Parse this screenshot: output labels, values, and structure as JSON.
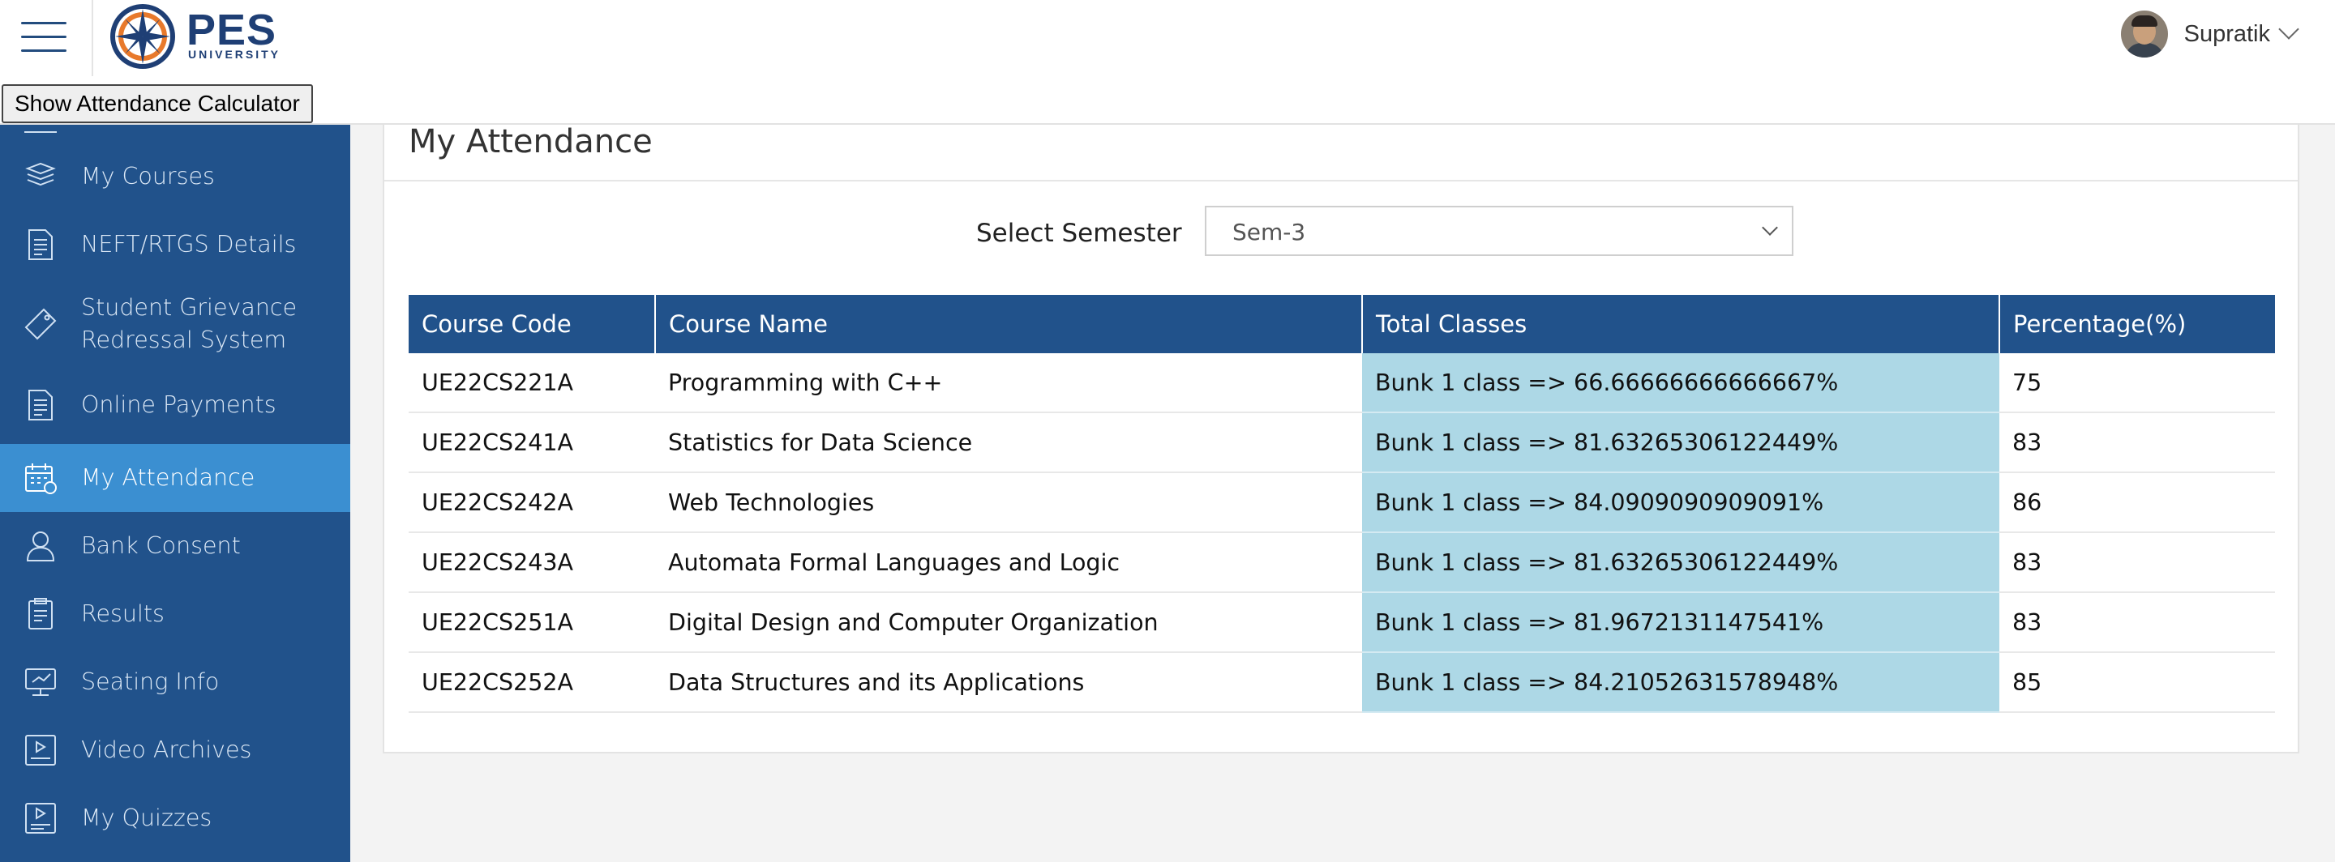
{
  "header": {
    "logo_text": "PES",
    "logo_subtext": "UNIVERSITY",
    "calculator_button": "Show Attendance Calculator",
    "user_name": "Supratik"
  },
  "sidebar": {
    "items": [
      {
        "label": "My Courses",
        "icon": "books-icon"
      },
      {
        "label": "NEFT/RTGS Details",
        "icon": "document-list-icon"
      },
      {
        "label": "Student Grievance",
        "label2": "Redressal System",
        "icon": "ticket-icon"
      },
      {
        "label": "Online Payments",
        "icon": "document-list-icon"
      },
      {
        "label": "My Attendance",
        "icon": "calendar-icon",
        "active": true
      },
      {
        "label": "Bank Consent",
        "icon": "user-icon"
      },
      {
        "label": "Results",
        "icon": "clipboard-icon"
      },
      {
        "label": "Seating Info",
        "icon": "monitor-icon"
      },
      {
        "label": "Video Archives",
        "icon": "video-icon"
      },
      {
        "label": "My Quizzes",
        "icon": "quiz-video-icon"
      }
    ]
  },
  "main": {
    "title": "My Attendance",
    "semester_label": "Select Semester",
    "semester_value": "Sem-3",
    "columns": [
      "Course Code",
      "Course Name",
      "Total Classes",
      "Percentage(%)"
    ],
    "rows": [
      {
        "code": "UE22CS221A",
        "name": "Programming with C++",
        "total": "Bunk 1 class => 66.66666666666667%",
        "percent": "75"
      },
      {
        "code": "UE22CS241A",
        "name": "Statistics for Data Science",
        "total": "Bunk 1 class => 81.63265306122449%",
        "percent": "83"
      },
      {
        "code": "UE22CS242A",
        "name": "Web Technologies",
        "total": "Bunk 1 class => 84.0909090909091%",
        "percent": "86"
      },
      {
        "code": "UE22CS243A",
        "name": "Automata Formal Languages and Logic",
        "total": "Bunk 1 class => 81.63265306122449%",
        "percent": "83"
      },
      {
        "code": "UE22CS251A",
        "name": "Digital Design and Computer Organization",
        "total": "Bunk 1 class => 81.9672131147541%",
        "percent": "83"
      },
      {
        "code": "UE22CS252A",
        "name": "Data Structures and its Applications",
        "total": "Bunk 1 class => 84.21052631578948%",
        "percent": "85"
      }
    ]
  },
  "colors": {
    "sidebar_bg": "#21528b",
    "sidebar_active": "#3b8fd1",
    "table_header": "#21528b",
    "total_cell": "#add8e6"
  }
}
